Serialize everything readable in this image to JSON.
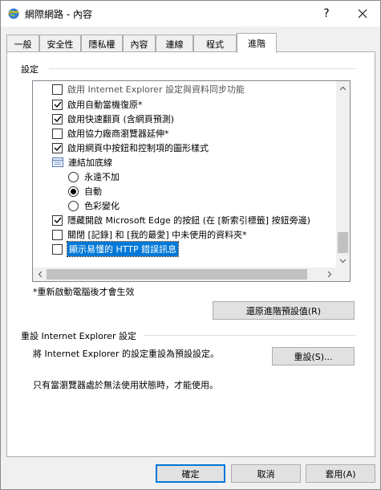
{
  "window": {
    "title": "網際網路 - 內容",
    "help_label": "?",
    "colors": {
      "accent": "#0078d7",
      "panel": "#ffffff",
      "chrome": "#f0f0f0"
    }
  },
  "tabs": [
    {
      "label": "一般"
    },
    {
      "label": "安全性"
    },
    {
      "label": "隱私權"
    },
    {
      "label": "內容"
    },
    {
      "label": "連線"
    },
    {
      "label": "程式"
    },
    {
      "label": "進階"
    }
  ],
  "active_tab": "進階",
  "settings": {
    "group_label": "設定",
    "items": [
      {
        "type": "checkbox",
        "checked": false,
        "label": "啟用 Internet Explorer 設定與資料同步功能"
      },
      {
        "type": "checkbox",
        "checked": true,
        "label": "啟用自動當機復原*"
      },
      {
        "type": "checkbox",
        "checked": true,
        "label": "啟用快速翻頁 (含網頁預測)"
      },
      {
        "type": "checkbox",
        "checked": false,
        "label": "啟用協力廠商瀏覽器延伸*"
      },
      {
        "type": "checkbox",
        "checked": true,
        "label": "啟用網頁中按鈕和控制項的圖形樣式"
      },
      {
        "type": "folder",
        "label": "連結加底線"
      },
      {
        "type": "radio",
        "checked": false,
        "label": "永遠不加"
      },
      {
        "type": "radio",
        "checked": true,
        "label": "自動"
      },
      {
        "type": "radio",
        "checked": false,
        "label": "色彩變化"
      },
      {
        "type": "checkbox",
        "checked": true,
        "label": "隱藏開啟 Microsoft Edge 的按鈕 (在 [新索引標籤] 按鈕旁邊)"
      },
      {
        "type": "checkbox",
        "checked": false,
        "label": "關閉 [記錄] 和 [我的最愛] 中未使用的資料夾*"
      },
      {
        "type": "checkbox",
        "checked": false,
        "label": "顯示易懂的 HTTP 錯誤訊息",
        "selected": true
      }
    ],
    "restart_note": "*重新啟動電腦後才會生效",
    "restore_advanced_button": "還原進階預設值(R)"
  },
  "reset": {
    "section_title": "重設 Internet Explorer 設定",
    "description": "將 Internet Explorer 的設定重設為預設設定。",
    "reset_button": "重設(S)...",
    "note": "只有當瀏覽器處於無法使用狀態時，才能使用。"
  },
  "footer": {
    "ok_label": "確定",
    "cancel_label": "取消",
    "apply_label": "套用(A)"
  }
}
